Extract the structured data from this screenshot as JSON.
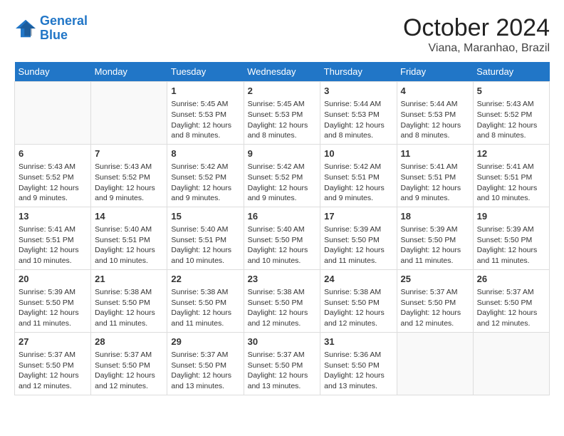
{
  "header": {
    "logo_line1": "General",
    "logo_line2": "Blue",
    "month": "October 2024",
    "location": "Viana, Maranhao, Brazil"
  },
  "days_of_week": [
    "Sunday",
    "Monday",
    "Tuesday",
    "Wednesday",
    "Thursday",
    "Friday",
    "Saturday"
  ],
  "weeks": [
    [
      {
        "day": "",
        "info": ""
      },
      {
        "day": "",
        "info": ""
      },
      {
        "day": "1",
        "info": "Sunrise: 5:45 AM\nSunset: 5:53 PM\nDaylight: 12 hours\nand 8 minutes."
      },
      {
        "day": "2",
        "info": "Sunrise: 5:45 AM\nSunset: 5:53 PM\nDaylight: 12 hours\nand 8 minutes."
      },
      {
        "day": "3",
        "info": "Sunrise: 5:44 AM\nSunset: 5:53 PM\nDaylight: 12 hours\nand 8 minutes."
      },
      {
        "day": "4",
        "info": "Sunrise: 5:44 AM\nSunset: 5:53 PM\nDaylight: 12 hours\nand 8 minutes."
      },
      {
        "day": "5",
        "info": "Sunrise: 5:43 AM\nSunset: 5:52 PM\nDaylight: 12 hours\nand 8 minutes."
      }
    ],
    [
      {
        "day": "6",
        "info": "Sunrise: 5:43 AM\nSunset: 5:52 PM\nDaylight: 12 hours\nand 9 minutes."
      },
      {
        "day": "7",
        "info": "Sunrise: 5:43 AM\nSunset: 5:52 PM\nDaylight: 12 hours\nand 9 minutes."
      },
      {
        "day": "8",
        "info": "Sunrise: 5:42 AM\nSunset: 5:52 PM\nDaylight: 12 hours\nand 9 minutes."
      },
      {
        "day": "9",
        "info": "Sunrise: 5:42 AM\nSunset: 5:52 PM\nDaylight: 12 hours\nand 9 minutes."
      },
      {
        "day": "10",
        "info": "Sunrise: 5:42 AM\nSunset: 5:51 PM\nDaylight: 12 hours\nand 9 minutes."
      },
      {
        "day": "11",
        "info": "Sunrise: 5:41 AM\nSunset: 5:51 PM\nDaylight: 12 hours\nand 9 minutes."
      },
      {
        "day": "12",
        "info": "Sunrise: 5:41 AM\nSunset: 5:51 PM\nDaylight: 12 hours\nand 10 minutes."
      }
    ],
    [
      {
        "day": "13",
        "info": "Sunrise: 5:41 AM\nSunset: 5:51 PM\nDaylight: 12 hours\nand 10 minutes."
      },
      {
        "day": "14",
        "info": "Sunrise: 5:40 AM\nSunset: 5:51 PM\nDaylight: 12 hours\nand 10 minutes."
      },
      {
        "day": "15",
        "info": "Sunrise: 5:40 AM\nSunset: 5:51 PM\nDaylight: 12 hours\nand 10 minutes."
      },
      {
        "day": "16",
        "info": "Sunrise: 5:40 AM\nSunset: 5:50 PM\nDaylight: 12 hours\nand 10 minutes."
      },
      {
        "day": "17",
        "info": "Sunrise: 5:39 AM\nSunset: 5:50 PM\nDaylight: 12 hours\nand 11 minutes."
      },
      {
        "day": "18",
        "info": "Sunrise: 5:39 AM\nSunset: 5:50 PM\nDaylight: 12 hours\nand 11 minutes."
      },
      {
        "day": "19",
        "info": "Sunrise: 5:39 AM\nSunset: 5:50 PM\nDaylight: 12 hours\nand 11 minutes."
      }
    ],
    [
      {
        "day": "20",
        "info": "Sunrise: 5:39 AM\nSunset: 5:50 PM\nDaylight: 12 hours\nand 11 minutes."
      },
      {
        "day": "21",
        "info": "Sunrise: 5:38 AM\nSunset: 5:50 PM\nDaylight: 12 hours\nand 11 minutes."
      },
      {
        "day": "22",
        "info": "Sunrise: 5:38 AM\nSunset: 5:50 PM\nDaylight: 12 hours\nand 11 minutes."
      },
      {
        "day": "23",
        "info": "Sunrise: 5:38 AM\nSunset: 5:50 PM\nDaylight: 12 hours\nand 12 minutes."
      },
      {
        "day": "24",
        "info": "Sunrise: 5:38 AM\nSunset: 5:50 PM\nDaylight: 12 hours\nand 12 minutes."
      },
      {
        "day": "25",
        "info": "Sunrise: 5:37 AM\nSunset: 5:50 PM\nDaylight: 12 hours\nand 12 minutes."
      },
      {
        "day": "26",
        "info": "Sunrise: 5:37 AM\nSunset: 5:50 PM\nDaylight: 12 hours\nand 12 minutes."
      }
    ],
    [
      {
        "day": "27",
        "info": "Sunrise: 5:37 AM\nSunset: 5:50 PM\nDaylight: 12 hours\nand 12 minutes."
      },
      {
        "day": "28",
        "info": "Sunrise: 5:37 AM\nSunset: 5:50 PM\nDaylight: 12 hours\nand 12 minutes."
      },
      {
        "day": "29",
        "info": "Sunrise: 5:37 AM\nSunset: 5:50 PM\nDaylight: 12 hours\nand 13 minutes."
      },
      {
        "day": "30",
        "info": "Sunrise: 5:37 AM\nSunset: 5:50 PM\nDaylight: 12 hours\nand 13 minutes."
      },
      {
        "day": "31",
        "info": "Sunrise: 5:36 AM\nSunset: 5:50 PM\nDaylight: 12 hours\nand 13 minutes."
      },
      {
        "day": "",
        "info": ""
      },
      {
        "day": "",
        "info": ""
      }
    ]
  ]
}
